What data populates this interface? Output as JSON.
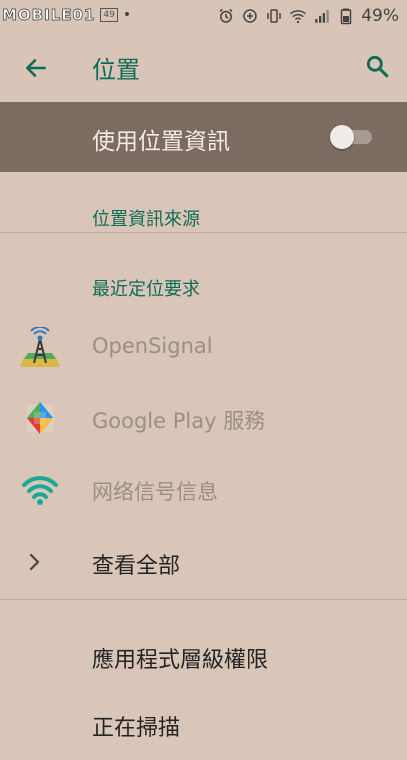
{
  "status_bar": {
    "logo_text": "MOBILE01",
    "notification_badge": "49",
    "battery_percent": "49%",
    "icons": [
      "alarm-icon",
      "data-saver-icon",
      "vibrate-icon",
      "wifi-icon",
      "cellular-signal-icon",
      "battery-icon"
    ]
  },
  "app_bar": {
    "title": "位置",
    "back_icon": "arrow-back-icon",
    "search_icon": "search-icon"
  },
  "master_switch": {
    "label": "使用位置資訊",
    "enabled": false
  },
  "sections": {
    "location_sources": "位置資訊來源",
    "recent_requests": "最近定位要求"
  },
  "recent_apps": [
    {
      "label": "OpenSignal",
      "icon": "opensignal-app-icon"
    },
    {
      "label": "Google Play 服務",
      "icon": "google-play-services-icon"
    },
    {
      "label": "网络信号信息",
      "icon": "network-signal-info-icon"
    }
  ],
  "see_all": {
    "label": "查看全部",
    "icon": "chevron-right-icon"
  },
  "bottom_items": [
    {
      "label": "應用程式層級權限"
    },
    {
      "label": "正在掃描"
    }
  ],
  "colors": {
    "background": "#d9c6b8",
    "accent": "#0f6b57",
    "master_row": "#7b6b61",
    "disabled_text": "#9b8e86"
  }
}
